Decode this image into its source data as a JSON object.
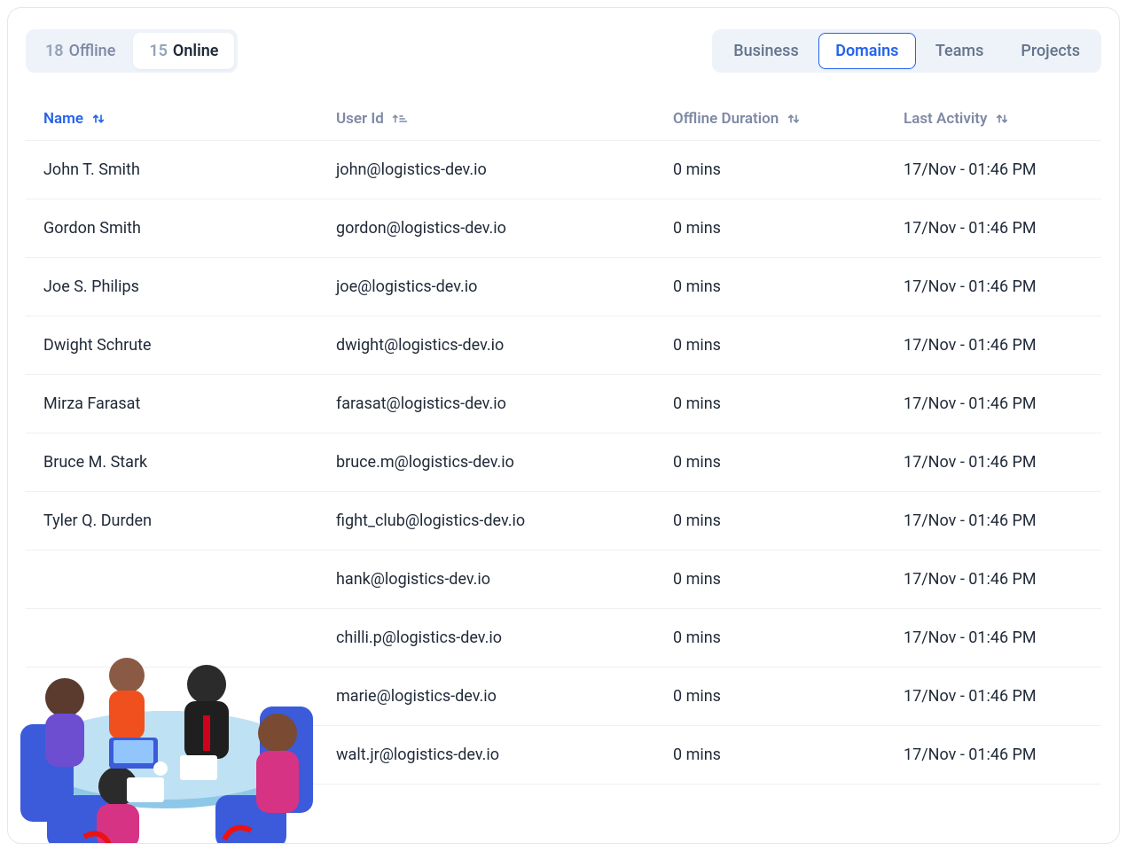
{
  "status_toggle": {
    "offline": {
      "count": "18",
      "label": "Offline"
    },
    "online": {
      "count": "15",
      "label": "Online"
    },
    "active": "online"
  },
  "filter_tabs": {
    "items": [
      "Business",
      "Domains",
      "Teams",
      "Projects"
    ],
    "active": "Domains"
  },
  "columns": {
    "name": {
      "label": "Name",
      "sort": "none",
      "active": true
    },
    "userid": {
      "label": "User Id",
      "sort": "asc",
      "active": false
    },
    "offline_duration": {
      "label": "Offline Duration",
      "sort": "none",
      "active": false
    },
    "last_activity": {
      "label": "Last Activity",
      "sort": "none",
      "active": false
    }
  },
  "rows": [
    {
      "name": "John T. Smith",
      "user_id": "john@logistics-dev.io",
      "offline_duration": "0 mins",
      "last_activity": "17/Nov - 01:46 PM"
    },
    {
      "name": "Gordon Smith",
      "user_id": "gordon@logistics-dev.io",
      "offline_duration": "0 mins",
      "last_activity": "17/Nov - 01:46 PM"
    },
    {
      "name": "Joe S. Philips",
      "user_id": "joe@logistics-dev.io",
      "offline_duration": "0 mins",
      "last_activity": "17/Nov - 01:46 PM"
    },
    {
      "name": "Dwight Schrute",
      "user_id": "dwight@logistics-dev.io",
      "offline_duration": "0 mins",
      "last_activity": "17/Nov - 01:46 PM"
    },
    {
      "name": "Mirza Farasat",
      "user_id": "farasat@logistics-dev.io",
      "offline_duration": "0 mins",
      "last_activity": "17/Nov - 01:46 PM"
    },
    {
      "name": "Bruce M. Stark",
      "user_id": "bruce.m@logistics-dev.io",
      "offline_duration": "0 mins",
      "last_activity": "17/Nov - 01:46 PM"
    },
    {
      "name": "Tyler Q. Durden",
      "user_id": "fight_club@logistics-dev.io",
      "offline_duration": "0 mins",
      "last_activity": "17/Nov - 01:46 PM"
    },
    {
      "name": "",
      "user_id": "hank@logistics-dev.io",
      "offline_duration": "0 mins",
      "last_activity": "17/Nov - 01:46 PM"
    },
    {
      "name": "",
      "user_id": "chilli.p@logistics-dev.io",
      "offline_duration": "0 mins",
      "last_activity": "17/Nov - 01:46 PM"
    },
    {
      "name": "",
      "user_id": "marie@logistics-dev.io",
      "offline_duration": "0 mins",
      "last_activity": "17/Nov - 01:46 PM"
    },
    {
      "name": "",
      "user_id": "walt.jr@logistics-dev.io",
      "offline_duration": "0 mins",
      "last_activity": "17/Nov - 01:46 PM"
    }
  ]
}
